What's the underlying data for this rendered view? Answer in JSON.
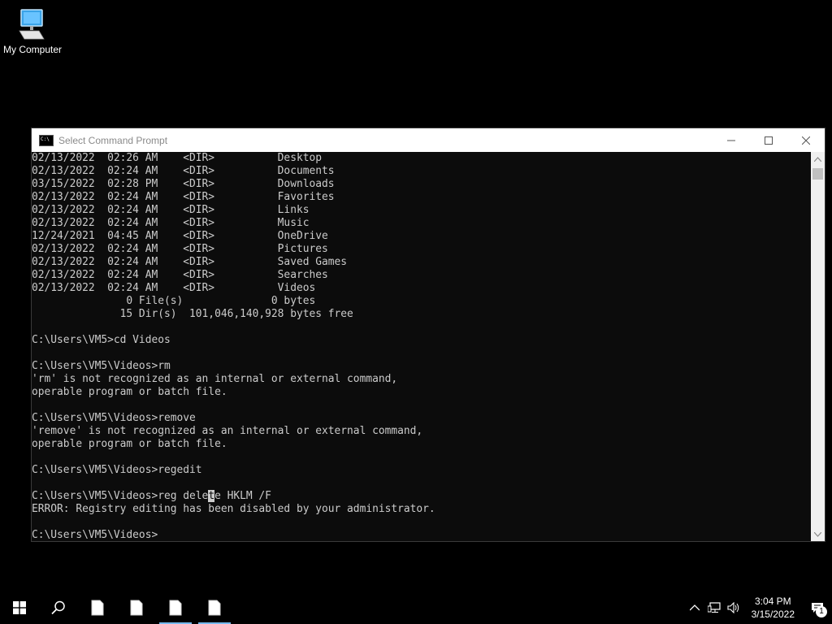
{
  "desktop": {
    "icons": [
      {
        "label": "My Computer",
        "icon": "computer-monitor-icon"
      }
    ]
  },
  "window": {
    "title": "Select Command Prompt",
    "icon": "command-prompt-icon",
    "controls": {
      "minimize": "minimize-icon",
      "maximize": "maximize-icon",
      "close": "close-icon"
    }
  },
  "console": {
    "lines": [
      "02/13/2022  02:26 AM    <DIR>          Desktop",
      "02/13/2022  02:24 AM    <DIR>          Documents",
      "03/15/2022  02:28 PM    <DIR>          Downloads",
      "02/13/2022  02:24 AM    <DIR>          Favorites",
      "02/13/2022  02:24 AM    <DIR>          Links",
      "02/13/2022  02:24 AM    <DIR>          Music",
      "12/24/2021  04:45 AM    <DIR>          OneDrive",
      "02/13/2022  02:24 AM    <DIR>          Pictures",
      "02/13/2022  02:24 AM    <DIR>          Saved Games",
      "02/13/2022  02:24 AM    <DIR>          Searches",
      "02/13/2022  02:24 AM    <DIR>          Videos",
      "               0 File(s)              0 bytes",
      "              15 Dir(s)  101,046,140,928 bytes free",
      "",
      "C:\\Users\\VM5>cd Videos",
      "",
      "C:\\Users\\VM5\\Videos>rm",
      "'rm' is not recognized as an internal or external command,",
      "operable program or batch file.",
      "",
      "C:\\Users\\VM5\\Videos>remove",
      "'remove' is not recognized as an internal or external command,",
      "operable program or batch file.",
      "",
      "C:\\Users\\VM5\\Videos>regedit",
      "",
      "C:\\Users\\VM5\\Videos>reg delete HKLM /F",
      "ERROR: Registry editing has been disabled by your administrator.",
      "",
      "C:\\Users\\VM5\\Videos>"
    ],
    "cursor_line_index": 26,
    "cursor_char_index": 28
  },
  "taskbar": {
    "start_icon": "windows-start-icon",
    "search_icon": "search-icon",
    "apps": [
      {
        "icon": "document-icon",
        "active": false
      },
      {
        "icon": "document-icon",
        "active": false
      },
      {
        "icon": "document-icon",
        "active": true
      },
      {
        "icon": "document-icon",
        "active": true
      }
    ],
    "tray": {
      "chevron_icon": "chevron-up-icon",
      "network_icon": "network-icon",
      "volume_icon": "volume-icon",
      "time": "3:04 PM",
      "date": "3/15/2022",
      "notification_icon": "action-center-icon",
      "notification_count": "1"
    }
  }
}
